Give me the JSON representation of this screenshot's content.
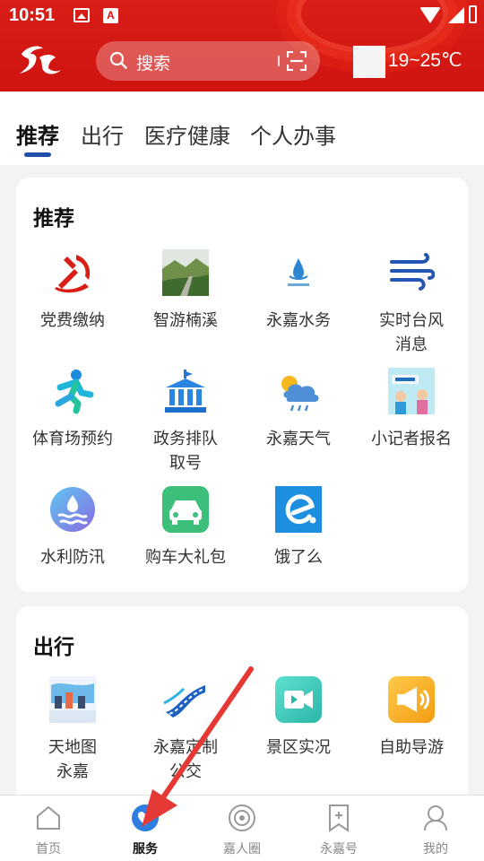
{
  "status_bar": {
    "time": "10:51",
    "a_badge": "A"
  },
  "header": {
    "search_placeholder": "搜索",
    "weather_temp": "19~25℃"
  },
  "tabs": [
    {
      "label": "推荐",
      "active": true
    },
    {
      "label": "出行",
      "active": false
    },
    {
      "label": "医疗健康",
      "active": false
    },
    {
      "label": "个人办事",
      "active": false
    }
  ],
  "recommend": {
    "title": "推荐",
    "items": [
      {
        "label": "党费缴纳",
        "icon": "party-emblem-icon"
      },
      {
        "label": "智游楠溪",
        "icon": "landscape-photo-icon"
      },
      {
        "label": "永嘉水务",
        "icon": "water-drop-logo-icon"
      },
      {
        "label": "实时台风消息",
        "icon": "wind-icon"
      },
      {
        "label": "体育场预约",
        "icon": "running-person-icon"
      },
      {
        "label": "政务排队取号",
        "icon": "government-building-icon"
      },
      {
        "label": "永嘉天气",
        "icon": "weather-cloud-icon"
      },
      {
        "label": "小记者报名",
        "icon": "reporter-poster-icon"
      },
      {
        "label": "水利防汛",
        "icon": "water-wave-icon"
      },
      {
        "label": "购车大礼包",
        "icon": "car-icon"
      },
      {
        "label": "饿了么",
        "icon": "eleme-logo-icon"
      }
    ],
    "item_lines": [
      [
        "党费缴纳"
      ],
      [
        "智游楠溪"
      ],
      [
        "永嘉水务"
      ],
      [
        "实时台风",
        "消息"
      ],
      [
        "体育场预约"
      ],
      [
        "政务排队",
        "取号"
      ],
      [
        "永嘉天气"
      ],
      [
        "小记者报名"
      ],
      [
        "水利防汛"
      ],
      [
        "购车大礼包"
      ],
      [
        "饿了么"
      ]
    ]
  },
  "travel": {
    "title": "出行",
    "items": [
      {
        "label": "天地图永嘉",
        "icon": "map-tile-icon"
      },
      {
        "label": "永嘉定制公交",
        "icon": "highway-icon"
      },
      {
        "label": "景区实况",
        "icon": "video-camera-icon"
      },
      {
        "label": "自助导游",
        "icon": "megaphone-icon"
      }
    ],
    "item_lines": [
      [
        "天地图",
        "永嘉"
      ],
      [
        "永嘉定制",
        "公交"
      ],
      [
        "景区实况"
      ],
      [
        "自助导游"
      ]
    ]
  },
  "bottom_nav": [
    {
      "label": "首页",
      "icon": "home-icon",
      "active": false
    },
    {
      "label": "服务",
      "icon": "service-heart-icon",
      "active": true
    },
    {
      "label": "嘉人圈",
      "icon": "circle-icon",
      "active": false
    },
    {
      "label": "永嘉号",
      "icon": "bookmark-plus-icon",
      "active": false
    },
    {
      "label": "我的",
      "icon": "profile-icon",
      "active": false
    }
  ],
  "colors": {
    "header_red": "#d11a15",
    "accent_blue": "#1f4fa8",
    "annotation_red": "#e53935"
  }
}
